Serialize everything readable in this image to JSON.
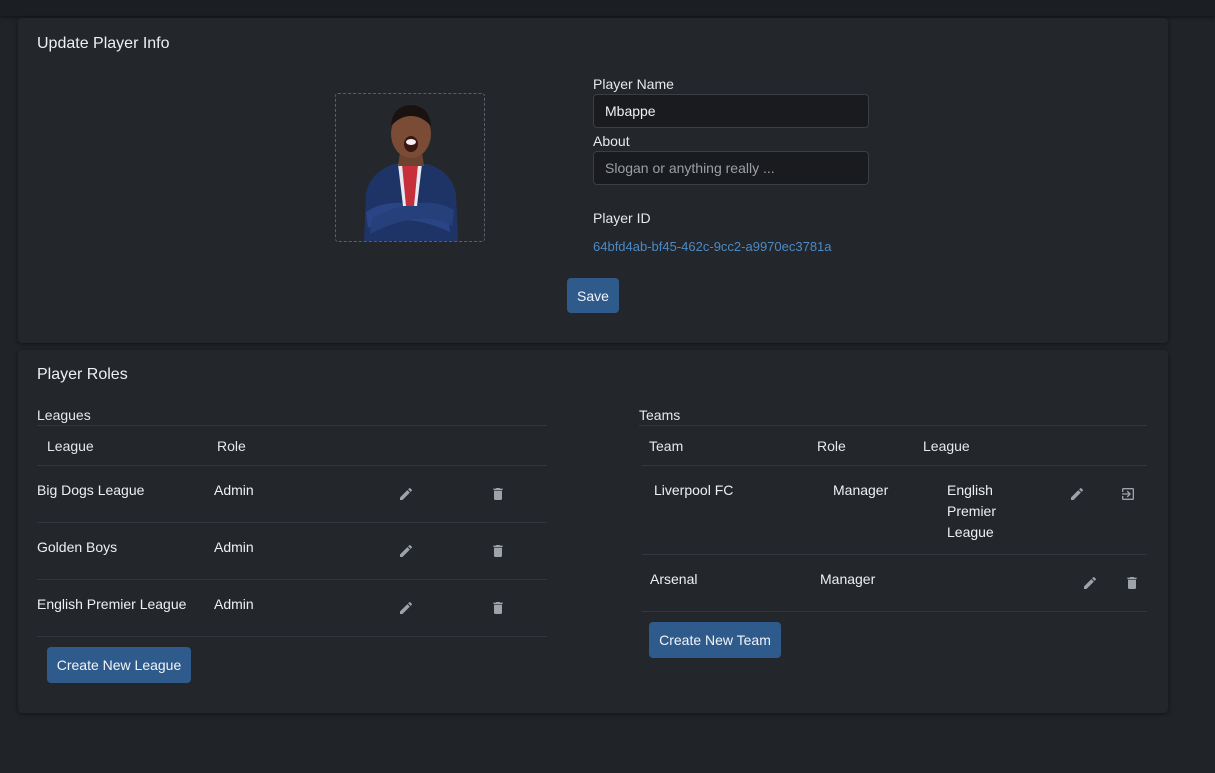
{
  "player_info": {
    "title": "Update Player Info",
    "name_label": "Player Name",
    "name_value": "Mbappe",
    "about_label": "About",
    "about_placeholder": "Slogan or anything really ...",
    "id_label": "Player ID",
    "id_value": "64bfd4ab-bf45-462c-9cc2-a9970ec3781a",
    "save_label": "Save"
  },
  "roles": {
    "title": "Player Roles",
    "leagues": {
      "label": "Leagues",
      "headers": [
        "League",
        "Role"
      ],
      "rows": [
        {
          "league": "Big Dogs League",
          "role": "Admin"
        },
        {
          "league": "Golden Boys",
          "role": "Admin"
        },
        {
          "league": "English Premier League",
          "role": "Admin"
        }
      ],
      "create_label": "Create New League"
    },
    "teams": {
      "label": "Teams",
      "headers": [
        "Team",
        "Role",
        "League"
      ],
      "rows": [
        {
          "team": "Liverpool FC",
          "role": "Manager",
          "league": "English Premier League"
        },
        {
          "team": "Arsenal",
          "role": "Manager",
          "league": ""
        }
      ],
      "create_label": "Create New Team"
    }
  },
  "icons": {
    "edit": "pencil-icon",
    "delete": "trash-icon",
    "leave": "exit-icon"
  },
  "colors": {
    "background": "#202328",
    "card": "#23262b",
    "accent_button": "#2f5b8c",
    "link": "#4c8ac4"
  }
}
